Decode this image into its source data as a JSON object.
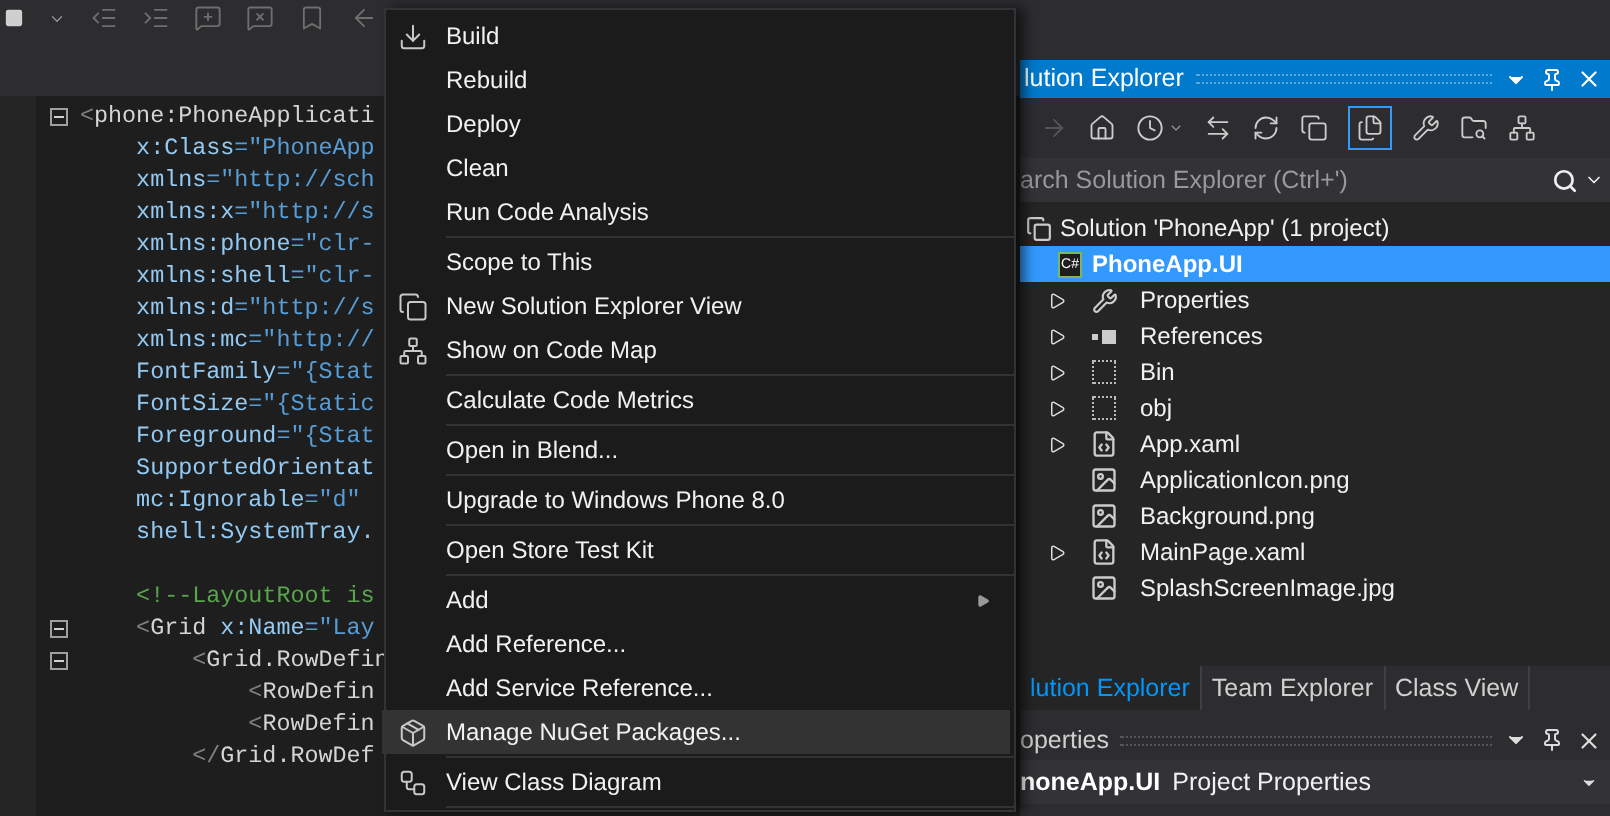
{
  "editor": {
    "lines": [
      {
        "fold": true,
        "parts": [
          {
            "kind": "punct",
            "text": "<"
          },
          {
            "kind": "element",
            "text": "phone:PhoneApplicati"
          }
        ]
      },
      {
        "fold": false,
        "parts": [
          {
            "kind": "attr",
            "text": "    x:Class"
          },
          {
            "kind": "value",
            "text": "=\"PhoneApp"
          }
        ]
      },
      {
        "fold": false,
        "parts": [
          {
            "kind": "attr",
            "text": "    xmlns"
          },
          {
            "kind": "value",
            "text": "=\"http://sch"
          }
        ]
      },
      {
        "fold": false,
        "parts": [
          {
            "kind": "attr",
            "text": "    xmlns:x"
          },
          {
            "kind": "value",
            "text": "=\"http://s"
          }
        ]
      },
      {
        "fold": false,
        "parts": [
          {
            "kind": "attr",
            "text": "    xmlns:phone"
          },
          {
            "kind": "value",
            "text": "=\"clr-"
          }
        ]
      },
      {
        "fold": false,
        "parts": [
          {
            "kind": "attr",
            "text": "    xmlns:shell"
          },
          {
            "kind": "value",
            "text": "=\"clr-"
          }
        ]
      },
      {
        "fold": false,
        "parts": [
          {
            "kind": "attr",
            "text": "    xmlns:d"
          },
          {
            "kind": "value",
            "text": "=\"http://s"
          }
        ]
      },
      {
        "fold": false,
        "parts": [
          {
            "kind": "attr",
            "text": "    xmlns:mc"
          },
          {
            "kind": "value",
            "text": "=\"http://"
          }
        ]
      },
      {
        "fold": false,
        "parts": [
          {
            "kind": "attr",
            "text": "    FontFamily"
          },
          {
            "kind": "value",
            "text": "=\"{Stat"
          }
        ]
      },
      {
        "fold": false,
        "parts": [
          {
            "kind": "attr",
            "text": "    FontSize"
          },
          {
            "kind": "value",
            "text": "=\"{Static"
          }
        ]
      },
      {
        "fold": false,
        "parts": [
          {
            "kind": "attr",
            "text": "    Foreground"
          },
          {
            "kind": "value",
            "text": "=\"{Stat"
          }
        ]
      },
      {
        "fold": false,
        "parts": [
          {
            "kind": "attr",
            "text": "    SupportedOrientat"
          }
        ]
      },
      {
        "fold": false,
        "parts": [
          {
            "kind": "attr",
            "text": "    mc:Ignorable"
          },
          {
            "kind": "value",
            "text": "=\"d\""
          }
        ]
      },
      {
        "fold": false,
        "parts": [
          {
            "kind": "attr",
            "text": "    shell:SystemTray."
          }
        ]
      },
      {
        "fold": false
      },
      {
        "fold": false,
        "parts": [
          {
            "kind": "comment",
            "text": "    <!--LayoutRoot is"
          }
        ]
      },
      {
        "fold": true,
        "parts": [
          {
            "kind": "punct",
            "text": "    <"
          },
          {
            "kind": "element",
            "text": "Grid"
          },
          {
            "kind": "attr",
            "text": " x:Name"
          },
          {
            "kind": "value",
            "text": "=\"Lay"
          }
        ]
      },
      {
        "fold": true,
        "parts": [
          {
            "kind": "punct",
            "text": "        <"
          },
          {
            "kind": "element",
            "text": "Grid.RowDefin"
          }
        ]
      },
      {
        "fold": false,
        "parts": [
          {
            "kind": "punct",
            "text": "            <"
          },
          {
            "kind": "element",
            "text": "RowDefin"
          }
        ]
      },
      {
        "fold": false,
        "parts": [
          {
            "kind": "punct",
            "text": "            <"
          },
          {
            "kind": "element",
            "text": "RowDefin"
          }
        ]
      },
      {
        "fold": false,
        "parts": [
          {
            "kind": "punct",
            "text": "        </"
          },
          {
            "kind": "element",
            "text": "Grid.RowDef"
          }
        ]
      }
    ]
  },
  "context_menu": {
    "groups": [
      [
        {
          "label": "Build",
          "kind": "build",
          "highlighted": false,
          "submenu": false
        },
        {
          "label": "Rebuild",
          "kind": "plain",
          "highlighted": false,
          "submenu": false
        },
        {
          "label": "Deploy",
          "kind": "plain",
          "highlighted": false,
          "submenu": false
        },
        {
          "label": "Clean",
          "kind": "plain",
          "highlighted": false,
          "submenu": false
        },
        {
          "label": "Run Code Analysis",
          "kind": "plain",
          "highlighted": false,
          "submenu": false
        }
      ],
      [
        {
          "label": "Scope to This",
          "kind": "plain",
          "highlighted": false,
          "submenu": false
        },
        {
          "label": "New Solution Explorer View",
          "kind": "view",
          "highlighted": false,
          "submenu": false
        },
        {
          "label": "Show on Code Map",
          "kind": "map",
          "highlighted": false,
          "submenu": false
        }
      ],
      [
        {
          "label": "Calculate Code Metrics",
          "kind": "plain",
          "highlighted": false,
          "submenu": false
        }
      ],
      [
        {
          "label": "Open in Blend...",
          "kind": "plain",
          "highlighted": false,
          "submenu": false
        }
      ],
      [
        {
          "label": "Upgrade to Windows Phone 8.0",
          "kind": "plain",
          "highlighted": false,
          "submenu": false
        }
      ],
      [
        {
          "label": "Open Store Test Kit",
          "kind": "plain",
          "highlighted": false,
          "submenu": false
        }
      ],
      [
        {
          "label": "Add",
          "kind": "plain",
          "highlighted": false,
          "submenu": true
        },
        {
          "label": "Add Reference...",
          "kind": "plain",
          "highlighted": false,
          "submenu": false
        },
        {
          "label": "Add Service Reference...",
          "kind": "plain",
          "highlighted": false,
          "submenu": false
        },
        {
          "label": "Manage NuGet Packages...",
          "kind": "nuget",
          "highlighted": true,
          "submenu": false
        }
      ],
      [
        {
          "label": "View Class Diagram",
          "kind": "diagram",
          "highlighted": false,
          "submenu": false
        }
      ]
    ]
  },
  "solution_explorer": {
    "title": "lution Explorer",
    "search": {
      "placeholder": "arch Solution Explorer (Ctrl+')"
    },
    "tree": [
      {
        "label": "Solution 'PhoneApp' (1 project)",
        "kind": "solution",
        "selected": false,
        "children": [
          {
            "label": "PhoneApp.UI",
            "kind": "project",
            "badge": "C#",
            "selected": true,
            "children": [
              {
                "label": "Properties",
                "kind": "properties",
                "selected": false,
                "expandable": true
              },
              {
                "label": "References",
                "kind": "references",
                "selected": false,
                "expandable": true
              },
              {
                "label": "Bin",
                "kind": "folder",
                "selected": false,
                "expandable": true
              },
              {
                "label": "obj",
                "kind": "folder",
                "selected": false,
                "expandable": true
              },
              {
                "label": "App.xaml",
                "kind": "xaml",
                "selected": false,
                "expandable": true
              },
              {
                "label": "ApplicationIcon.png",
                "kind": "image",
                "selected": false,
                "expandable": false
              },
              {
                "label": "Background.png",
                "kind": "image",
                "selected": false,
                "expandable": false
              },
              {
                "label": "MainPage.xaml",
                "kind": "xaml",
                "selected": false,
                "expandable": true
              },
              {
                "label": "SplashScreenImage.jpg",
                "kind": "image",
                "selected": false,
                "expandable": false
              }
            ]
          }
        ]
      }
    ],
    "tabs": [
      {
        "label": "lution Explorer",
        "selected": true
      },
      {
        "label": "Team Explorer",
        "selected": false
      },
      {
        "label": "Class View",
        "selected": false
      }
    ]
  },
  "properties": {
    "title": "operties",
    "object_name": "noneApp.UI",
    "object_type": "Project Properties"
  }
}
